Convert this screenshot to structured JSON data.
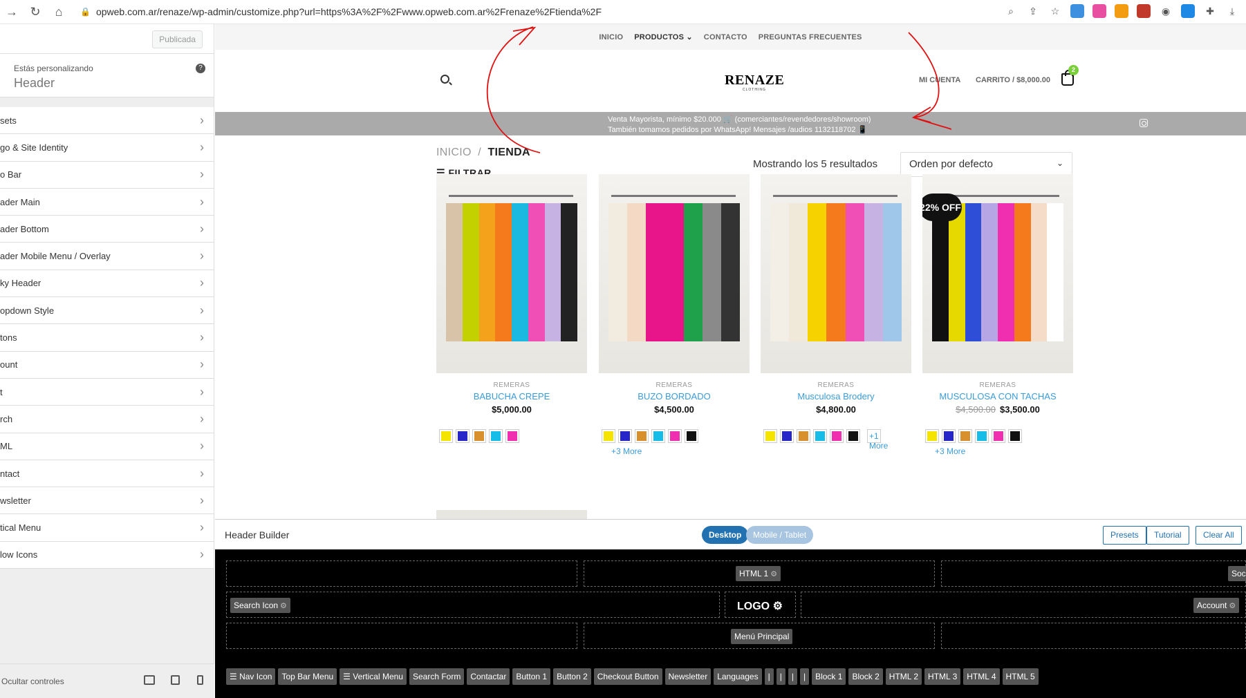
{
  "browser": {
    "url": "opweb.com.ar/renaze/wp-admin/customize.php?url=https%3A%2F%2Fwww.opweb.com.ar%2Frenaze%2Ftienda%2F"
  },
  "sidebar": {
    "publish_label": "Publicada",
    "customizing_label": "Estás personalizando",
    "section_title": "Header",
    "items": [
      {
        "label": "sets"
      },
      {
        "label": "go & Site Identity"
      },
      {
        "label": "o Bar"
      },
      {
        "label": "ader Main"
      },
      {
        "label": "ader Bottom"
      },
      {
        "label": "ader Mobile Menu / Overlay"
      },
      {
        "label": "ky Header"
      },
      {
        "label": "opdown Style"
      },
      {
        "label": "tons"
      },
      {
        "label": "ount"
      },
      {
        "label": "t"
      },
      {
        "label": "rch"
      },
      {
        "label": "ML"
      },
      {
        "label": "ntact"
      },
      {
        "label": "wsletter"
      },
      {
        "label": "tical Menu"
      },
      {
        "label": "low Icons"
      }
    ],
    "footer_label": "Ocultar controles"
  },
  "site": {
    "nav": [
      "INICIO",
      "PRODUCTOS",
      "CONTACTO",
      "PREGUNTAS FRECUENTES"
    ],
    "logo": "RENAZE",
    "logo_sub": "CLOTHING",
    "account": "MI CUENTA",
    "cart": "CARRITO / $8,000.00",
    "cart_count": "2",
    "promo_line1": "Venta Mayorista, mínimo $20.000 🛒 (comerciantes/revendedores/showroom)",
    "promo_line2": "También tomamos pedidos por WhatsApp! Mensajes /audios 1132118702 📱",
    "breadcrumb_home": "INICIO",
    "breadcrumb_sep": "/",
    "breadcrumb_current": "TIENDA",
    "filter_label": "FILTRAR",
    "results": "Mostrando los 5 resultados",
    "sort": "Orden por defecto"
  },
  "products": [
    {
      "category": "REMERAS",
      "name": "BABUCHA CREPE",
      "price": "$5,000.00",
      "old_price": "",
      "badge": "",
      "more": "",
      "swatches": [
        "#f5e400",
        "#2626c9",
        "#d8902f",
        "#17bde6",
        "#ef2fb0"
      ],
      "garments": [
        "#d9c3a8",
        "#c4d100",
        "#f4a21c",
        "#f47a1c",
        "#1bb9e0",
        "#f04fb5",
        "#c7b3e3",
        "#222"
      ]
    },
    {
      "category": "REMERAS",
      "name": "BUZO BORDADO",
      "price": "$4,500.00",
      "old_price": "",
      "badge": "",
      "more": "+3 More",
      "swatches": [
        "#f5e400",
        "#2626c9",
        "#d8902f",
        "#17bde6",
        "#ef2fb0",
        "#111111"
      ],
      "garments": [
        "#f1ebe0",
        "#f4d9c4",
        "#e8158a",
        "#e8158a",
        "#1fa04a",
        "#8a8a8a",
        "#333"
      ]
    },
    {
      "category": "REMERAS",
      "name": "Musculosa Brodery",
      "price": "$4,800.00",
      "old_price": "",
      "badge": "",
      "more": "+1 More",
      "swatches": [
        "#f5e400",
        "#2626c9",
        "#d8902f",
        "#17bde6",
        "#ef2fb0",
        "#111111"
      ],
      "garments": [
        "#f4efe6",
        "#f0e8d8",
        "#f5d200",
        "#f47a1c",
        "#f04fb5",
        "#c7b3e3",
        "#9ec7ea"
      ]
    },
    {
      "category": "REMERAS",
      "name": "MUSCULOSA CON TACHAS",
      "price": "$3,500.00",
      "old_price": "$4,500.00",
      "badge": "22% OFF",
      "more": "+3 More",
      "swatches": [
        "#f5e400",
        "#2626c9",
        "#d8902f",
        "#17bde6",
        "#ef2fb0",
        "#111111"
      ],
      "garments": [
        "#111",
        "#e6d900",
        "#2e4ed8",
        "#b7a6e6",
        "#ef2fb0",
        "#f47a1c",
        "#f5dcc8",
        "#fff"
      ]
    }
  ],
  "builder": {
    "title": "Header Builder",
    "desktop": "Desktop",
    "mobile": "Mobile / Tablet",
    "presets": "Presets",
    "tutorial": "Tutorial",
    "clear_all": "Clear All",
    "html1": "HTML 1",
    "social": "Soci",
    "search_icon": "Search Icon",
    "logo": "LOGO",
    "account": "Account",
    "main_menu": "Menú Principal",
    "tray": [
      "☰ Nav Icon",
      "Top Bar Menu",
      "☰ Vertical Menu",
      "Search Form",
      "Contactar",
      "Button 1",
      "Button 2",
      "Checkout Button",
      "Newsletter",
      "Languages",
      "|",
      "|",
      "|",
      "|",
      "Block 1",
      "Block 2",
      "HTML 2",
      "HTML 3",
      "HTML 4",
      "HTML 5"
    ]
  }
}
